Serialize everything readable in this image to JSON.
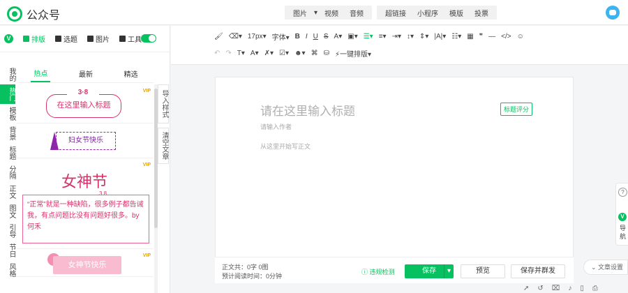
{
  "header": {
    "app_name": "公众号",
    "media_menu": [
      "图片",
      "视频",
      "音频"
    ],
    "insert_menu": [
      "超链接",
      "小程序",
      "模版",
      "投票"
    ]
  },
  "left_panel": {
    "tabs": [
      {
        "label": "排版",
        "active": true
      },
      {
        "label": "选题",
        "active": false
      },
      {
        "label": "图片",
        "active": false
      },
      {
        "label": "工具",
        "active": false
      }
    ],
    "categories": [
      "我的",
      "热门",
      "模板",
      "背景",
      "标题",
      "分隔",
      "正文",
      "图文",
      "引导",
      "节日",
      "风格"
    ],
    "active_category": "热门",
    "sub_tabs": [
      "热点",
      "最新",
      "精选"
    ],
    "active_sub_tab": "热点",
    "templates": [
      {
        "deco": "3·8",
        "text": "在这里输入标题",
        "vip": "VIP"
      },
      {
        "text": "妇女节快乐"
      },
      {
        "title": "女神节",
        "sub": "3.8",
        "text": "“正常”就是一种缺陷，很多例子都告诫我，有点问题比没有问题好很多。by何禾",
        "vip": "VIP"
      },
      {
        "text": "女神节快乐",
        "vip": "VIP"
      }
    ],
    "side_buttons": [
      "导入样式",
      "清空文章"
    ]
  },
  "toolbar": {
    "font_size": "17px",
    "font_family": "字体",
    "one_click_format": "一键排版"
  },
  "editor": {
    "title_placeholder": "请在这里输入标题",
    "score_button": "标题评分",
    "author_placeholder": "请输入作者",
    "body_placeholder": "从这里开始写正文"
  },
  "footer": {
    "word_count": "正文共：0字 0图",
    "read_time": "预计阅读时间：0分钟",
    "violation_check": "违规检测",
    "save": "保存",
    "preview": "预览",
    "save_and_publish": "保存并群发"
  },
  "article_settings": "文章设置",
  "right_float": {
    "label": "导航"
  },
  "colors": {
    "brand_green": "#07c160",
    "accent_pink": "#d6336c"
  }
}
